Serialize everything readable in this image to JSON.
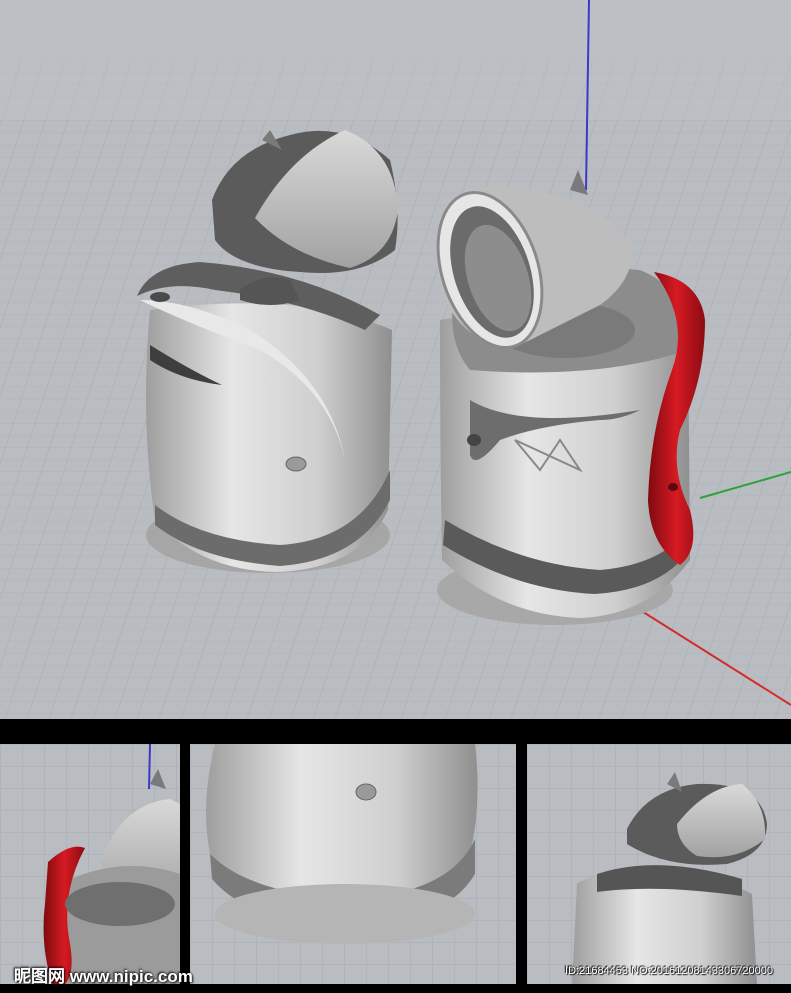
{
  "watermark": {
    "site": "昵图网 www.nipic.com",
    "id_text": "ID:21684453 NO:20161208143306720000"
  },
  "colors": {
    "grid_bg": "#b8bcc1",
    "grid_line": "#9ea3a9",
    "body_silver": "#c9c9c9",
    "body_dark": "#5c5c5c",
    "accent_red": "#c8151d",
    "axis_z": "#3a3ac8",
    "axis_x": "#d42a2a",
    "axis_y": "#2ea23a"
  },
  "viewports": [
    "main-perspective",
    "detail-left",
    "detail-center",
    "detail-right"
  ]
}
